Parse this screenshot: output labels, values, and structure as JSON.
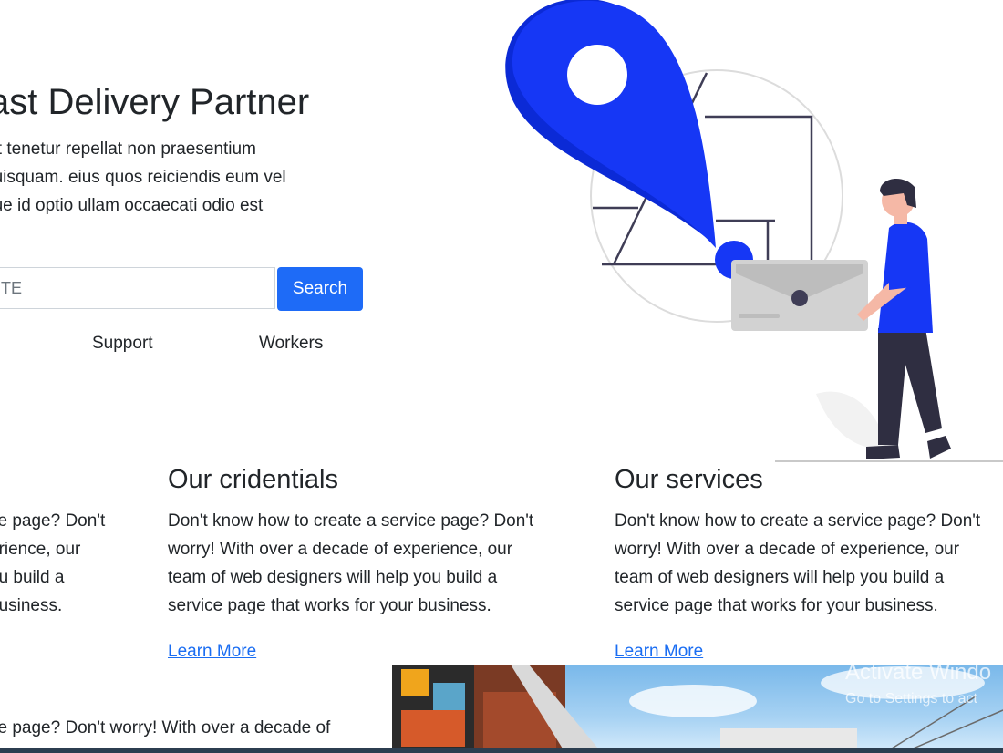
{
  "hero": {
    "title": "ast Delivery Partner",
    "text": "git tenetur repellat non praesentium\n quisquam. eius quos reiciendis eum vel\nque id optio ullam occaecati odio est"
  },
  "search": {
    "value": "TE",
    "button_label": "Search"
  },
  "nav": {
    "support": "Support",
    "workers": "Workers"
  },
  "cards": [
    {
      "title": "",
      "text": "ce page? Don't\nerience, our\nou build a\nbusiness.",
      "link": ""
    },
    {
      "title": "Our cridentials",
      "text": "Don't know how to create a service page? Don't\nworry! With over a decade of experience, our\nteam of web designers will help you build a\nservice page that works for your business.",
      "link": "Learn More"
    },
    {
      "title": "Our services",
      "text": "Don't know how to create a service page? Don't\nworry! With over a decade of experience, our\nteam of web designers will help you build a\nservice page that works for your business.",
      "link": "Learn More"
    }
  ],
  "bottom_text": "ce page? Don't worry! With over a decade of",
  "watermark": {
    "line1": "Activate Windo",
    "line2": "Go to Settings to act"
  },
  "icons": {
    "illustration": "delivery-illustration",
    "pin": "location-pin-icon"
  },
  "colors": {
    "accent": "#1e6bf7",
    "link": "#1a6df2",
    "illustration_blue": "#1637f5"
  }
}
